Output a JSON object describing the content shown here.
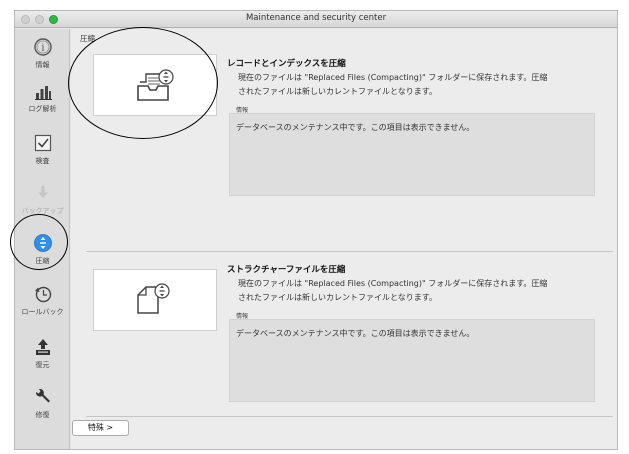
{
  "window": {
    "title": "Maintenance and security center"
  },
  "sidebar": {
    "items": [
      {
        "label": "情報",
        "icon": "info-icon"
      },
      {
        "label": "ログ解析",
        "icon": "bar-chart-icon"
      },
      {
        "label": "検査",
        "icon": "check-icon"
      },
      {
        "label": "バックアップ",
        "icon": "backup-arrow-icon",
        "disabled": true
      },
      {
        "label": "圧縮",
        "icon": "compress-icon",
        "selected": true
      },
      {
        "label": "ロールバック",
        "icon": "rollback-icon"
      },
      {
        "label": "復元",
        "icon": "restore-icon"
      },
      {
        "label": "修復",
        "icon": "repair-wrench-icon"
      }
    ]
  },
  "main": {
    "section_title": "圧縮",
    "tasks": [
      {
        "title": "レコードとインデックスを圧縮",
        "desc_line1": "現在のファイルは \"Replaced Files (Compacting)\" フォルダーに保存されます。圧縮",
        "desc_line2": "されたファイルは新しいカレントファイルとなります。",
        "info_label": "情報",
        "info_text": "データベースのメンテナンス中です。この項目は表示できません。",
        "icon": "tray-compress-icon"
      },
      {
        "title": "ストラクチャーファイルを圧縮",
        "desc_line1": "現在のファイルは \"Replaced Files (Compacting)\" フォルダーに保存されます。圧縮",
        "desc_line2": "されたファイルは新しいカレントファイルとなります。",
        "info_label": "情報",
        "info_text": "データベースのメンテナンス中です。この項目は表示できません。",
        "icon": "document-compress-icon"
      }
    ],
    "special_button": "特殊 >"
  }
}
